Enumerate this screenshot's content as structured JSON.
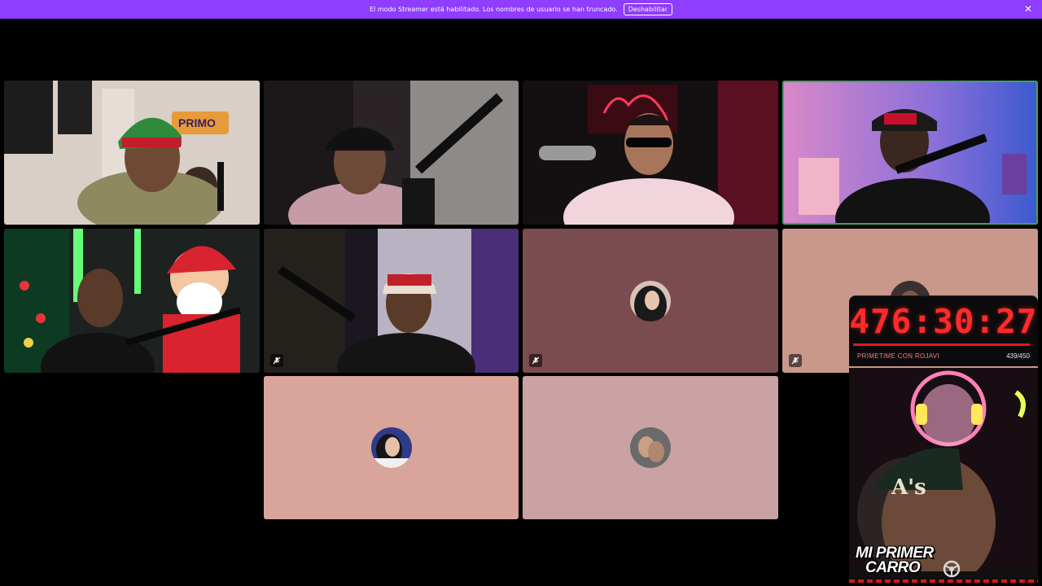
{
  "banner": {
    "message": "El modo Streamer está habilitado. Los nombres de usuario se han truncado.",
    "button_label": "Deshabilitar",
    "close_glyph": "✕",
    "background": "#8f3dff"
  },
  "grid": {
    "tiles": [
      {
        "name": "participant-tile-1",
        "kind": "video",
        "speaking": false,
        "muted": false,
        "caption": "PRIMO"
      },
      {
        "name": "participant-tile-2",
        "kind": "video",
        "speaking": false,
        "muted": false
      },
      {
        "name": "participant-tile-3",
        "kind": "video",
        "speaking": false,
        "muted": false
      },
      {
        "name": "participant-tile-4",
        "kind": "video",
        "speaking": true,
        "muted": false
      },
      {
        "name": "participant-tile-5",
        "kind": "video",
        "speaking": false,
        "muted": false
      },
      {
        "name": "participant-tile-6",
        "kind": "video",
        "speaking": false,
        "muted": true
      },
      {
        "name": "participant-tile-7",
        "kind": "avatar",
        "speaking": false,
        "muted": true,
        "background": "#7a4b4f"
      },
      {
        "name": "participant-tile-8",
        "kind": "avatar",
        "speaking": false,
        "muted": true,
        "background": "#c9988a"
      },
      {
        "name": "participant-tile-9",
        "kind": "avatar",
        "speaking": false,
        "muted": false,
        "background": "#d9a49a"
      },
      {
        "name": "participant-tile-10",
        "kind": "avatar",
        "speaking": false,
        "muted": false,
        "background": "#caa2a4"
      }
    ],
    "speaking_color": "#3ba55c"
  },
  "overlay": {
    "timer": {
      "value": "476:30:27",
      "label": "PRIMETIME CON ROJAVI",
      "count": "439/450",
      "progress_fraction": 0.9756,
      "color": "#ff2b2b"
    },
    "facecam": {
      "cap_text": "A's",
      "promo_line1": "MI PRIMER",
      "promo_line2": "CARRO"
    }
  },
  "icons": {
    "mute": "mic-muted-icon",
    "close": "close-icon",
    "wheel": "steering-wheel-icon"
  }
}
